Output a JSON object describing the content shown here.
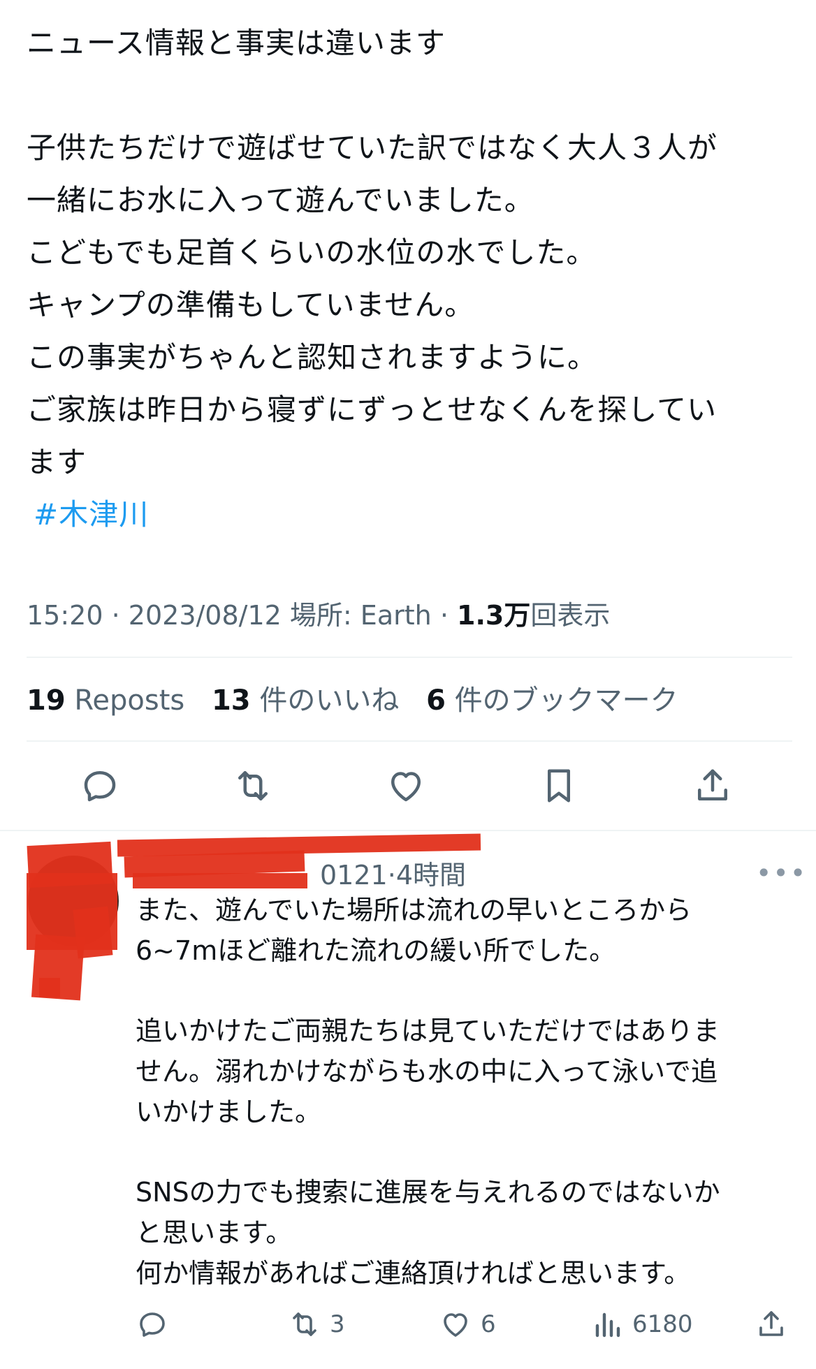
{
  "main_tweet": {
    "lines": [
      "ニュース情報と事実は違います",
      "",
      "子供たちだけで遊ばせていた訳ではなく大人３人が",
      "一緒にお水に入って遊んでいました。",
      "こどもでも足首くらいの水位の水でした。",
      "キャンプの準備もしていません。",
      "この事実がちゃんと認知されますように。",
      "ご家族は昨日から寝ずにずっとせなくんを探してい",
      "ます"
    ],
    "hashtag": "#木津川",
    "meta": {
      "time": "15:20",
      "date": "2023/08/12",
      "location": "場所: Earth",
      "views_count": "1.3万",
      "views_label": "回表示",
      "sep": "·"
    },
    "stats": {
      "reposts_count": "19",
      "reposts_label": "Reposts",
      "likes_count": "13",
      "likes_label": "件のいいね",
      "bookmarks_count": "6",
      "bookmarks_label": "件のブックマーク"
    },
    "actions": [
      "reply-icon",
      "repost-icon",
      "like-icon",
      "bookmark-icon",
      "share-icon"
    ]
  },
  "reply": {
    "handle_visible": "0121",
    "sep": "·",
    "time": "4時間",
    "more": "•••",
    "lines": [
      "また、遊んでいた場所は流れの早いところから",
      "6~7mほど離れた流れの緩い所でした。",
      "",
      "追いかけたご両親たちは見ていただけではありま",
      "せん。溺れかけながらも水の中に入って泳いで追",
      "いかけました。",
      "",
      "SNSの力でも捜索に進展を与えれるのではないか",
      "と思います。",
      "何か情報があればご連絡頂ければと思います。"
    ],
    "actions": {
      "reposts": "3",
      "likes": "6",
      "views": "6180"
    }
  },
  "colors": {
    "text": "#0f1419",
    "muted": "#536471",
    "link": "#1d9bf0",
    "divider": "#eff3f4",
    "redaction": "#e2301b"
  }
}
